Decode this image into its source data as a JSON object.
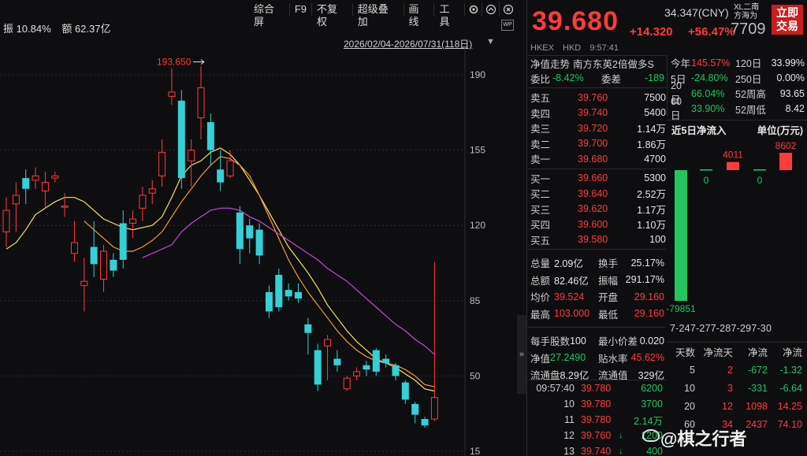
{
  "toolbar": {
    "items": [
      "综合屏",
      "F9",
      "不复权",
      "超级叠加",
      "画线",
      "工具"
    ],
    "icons": [
      "gear-icon",
      "chevron-up-icon",
      "close-icon"
    ]
  },
  "info": {
    "amplitude": "振 10.84%",
    "amount": "额 62.37亿"
  },
  "date_range": "2026/02/04-2026/07/31(118日)",
  "wp_badge": "WP",
  "chart_data": {
    "type": "candlestick",
    "y_ticks": [
      190,
      155,
      120,
      85,
      50,
      15
    ],
    "ylim": [
      15,
      190
    ],
    "annotation": "193.650",
    "candles": [
      {
        "o": 117,
        "c": 127,
        "h": 133,
        "l": 110
      },
      {
        "o": 130,
        "c": 134,
        "h": 140,
        "l": 117
      },
      {
        "o": 142,
        "c": 137,
        "h": 146,
        "l": 130
      },
      {
        "o": 141,
        "c": 143,
        "h": 147,
        "l": 137
      },
      {
        "o": 136,
        "c": 140,
        "h": 145,
        "l": 128
      },
      {
        "o": 142,
        "c": 143,
        "h": 145,
        "l": 140
      },
      {
        "o": 129,
        "c": 129,
        "h": 135,
        "l": 124
      },
      {
        "o": 107,
        "c": 112,
        "h": 122,
        "l": 103
      },
      {
        "o": 92,
        "c": 94,
        "h": 105,
        "l": 80
      },
      {
        "o": 110,
        "c": 102,
        "h": 122,
        "l": 96
      },
      {
        "o": 95,
        "c": 108,
        "h": 111,
        "l": 89
      },
      {
        "o": 104,
        "c": 99,
        "h": 107,
        "l": 96
      },
      {
        "o": 121,
        "c": 104,
        "h": 127,
        "l": 100
      },
      {
        "o": 121,
        "c": 123,
        "h": 127,
        "l": 114
      },
      {
        "o": 128,
        "c": 134,
        "h": 138,
        "l": 122
      },
      {
        "o": 135,
        "c": 137,
        "h": 141,
        "l": 130
      },
      {
        "o": 143,
        "c": 154,
        "h": 160,
        "l": 138
      },
      {
        "o": 180,
        "c": 182,
        "h": 193,
        "l": 176
      },
      {
        "o": 178,
        "c": 142,
        "h": 183,
        "l": 137
      },
      {
        "o": 150,
        "c": 155,
        "h": 160,
        "l": 138
      },
      {
        "o": 170,
        "c": 184,
        "h": 194,
        "l": 160
      },
      {
        "o": 168,
        "c": 155,
        "h": 172,
        "l": 148
      },
      {
        "o": 146,
        "c": 140,
        "h": 155,
        "l": 136
      },
      {
        "o": 143,
        "c": 150,
        "h": 155,
        "l": 142
      },
      {
        "o": 126,
        "c": 109,
        "h": 129,
        "l": 102
      },
      {
        "o": 120,
        "c": 114,
        "h": 123,
        "l": 107
      },
      {
        "o": 118,
        "c": 106,
        "h": 121,
        "l": 102
      },
      {
        "o": 89,
        "c": 80,
        "h": 92,
        "l": 77
      },
      {
        "o": 97,
        "c": 82,
        "h": 100,
        "l": 80
      },
      {
        "o": 90,
        "c": 87,
        "h": 93,
        "l": 85
      },
      {
        "o": 89,
        "c": 86,
        "h": 93,
        "l": 84
      },
      {
        "o": 74,
        "c": 70,
        "h": 77,
        "l": 60
      },
      {
        "o": 62,
        "c": 46,
        "h": 65,
        "l": 43
      },
      {
        "o": 64,
        "c": 67,
        "h": 69,
        "l": 48
      },
      {
        "o": 58,
        "c": 55,
        "h": 62,
        "l": 52
      },
      {
        "o": 44,
        "c": 49,
        "h": 50,
        "l": 43
      },
      {
        "o": 50,
        "c": 52,
        "h": 54,
        "l": 48
      },
      {
        "o": 55,
        "c": 53,
        "h": 57,
        "l": 50
      },
      {
        "o": 62,
        "c": 52,
        "h": 63,
        "l": 50
      },
      {
        "o": 58,
        "c": 56,
        "h": 60,
        "l": 54
      },
      {
        "o": 55,
        "c": 50,
        "h": 56,
        "l": 48
      },
      {
        "o": 47,
        "c": 39,
        "h": 48,
        "l": 37
      },
      {
        "o": 37,
        "c": 32,
        "h": 38,
        "l": 28
      },
      {
        "o": 30,
        "c": 27,
        "h": 31,
        "l": 26
      },
      {
        "o": 30,
        "c": 40,
        "h": 103,
        "l": 29
      }
    ],
    "ma_series": [
      {
        "color": "#f5e26a",
        "values": [
          109,
          112,
          118,
          125,
          128,
          131,
          133,
          133,
          131,
          127,
          123,
          121,
          119,
          118,
          119,
          120,
          124,
          133,
          143,
          148,
          150,
          154,
          156,
          153,
          148,
          141,
          134,
          126,
          118,
          110,
          104,
          98,
          91,
          83,
          77,
          71,
          66,
          62,
          58,
          56,
          54,
          51,
          48,
          44,
          43
        ]
      },
      {
        "color": "#f39c3a",
        "values": [
          null,
          null,
          null,
          null,
          null,
          null,
          null,
          null,
          122,
          118,
          114,
          110,
          108,
          108,
          110,
          113,
          117,
          124,
          131,
          137,
          143,
          148,
          152,
          151,
          148,
          143,
          134,
          124,
          114,
          104,
          96,
          89,
          83,
          77,
          71,
          66,
          62,
          59,
          57,
          56,
          55,
          53,
          50,
          46,
          45
        ]
      },
      {
        "color": "#c44ad6",
        "values": [
          null,
          null,
          null,
          null,
          null,
          null,
          null,
          null,
          null,
          null,
          null,
          null,
          null,
          null,
          105,
          107,
          109,
          111,
          117,
          121,
          124,
          127,
          128,
          128,
          127,
          124,
          122,
          119,
          116,
          113,
          110,
          107,
          104,
          100,
          97,
          94,
          90,
          86,
          82,
          78,
          74,
          71,
          67,
          64,
          60
        ]
      }
    ]
  },
  "quote": {
    "price": "39.680",
    "change": "+14.320",
    "change_pct": "+56.47%",
    "cny": "34.347(CNY)",
    "code_tail": "XL二南方海为",
    "code_num": "7709",
    "trade_button": "立即交易",
    "market": [
      "HKEX",
      "HKD",
      "9:57:41"
    ],
    "net_label": "净值走势",
    "fund_name": "南方东英2倍做多S",
    "weibi_label": "委比",
    "weibi": "-8.42%",
    "weicha_label": "委差",
    "weicha": "-189",
    "asks": [
      {
        "label": "卖五",
        "price": "39.760",
        "vol": "7500"
      },
      {
        "label": "卖四",
        "price": "39.740",
        "vol": "5400"
      },
      {
        "label": "卖三",
        "price": "39.720",
        "vol": "1.14万"
      },
      {
        "label": "卖二",
        "price": "39.700",
        "vol": "1.86万"
      },
      {
        "label": "卖一",
        "price": "39.680",
        "vol": "4700"
      }
    ],
    "bids": [
      {
        "label": "买一",
        "price": "39.660",
        "vol": "5300"
      },
      {
        "label": "买二",
        "price": "39.640",
        "vol": "2.52万"
      },
      {
        "label": "买三",
        "price": "39.620",
        "vol": "1.17万"
      },
      {
        "label": "买四",
        "price": "39.600",
        "vol": "1.10万"
      },
      {
        "label": "买五",
        "price": "39.580",
        "vol": "100"
      }
    ],
    "stats": [
      {
        "l": "总量",
        "v": "2.09亿",
        "vc": "white",
        "l2": "换手",
        "v2": "25.17%",
        "v2c": "white"
      },
      {
        "l": "总额",
        "v": "82.46亿",
        "vc": "white",
        "l2": "振幅",
        "v2": "291.17%",
        "v2c": "white"
      },
      {
        "l": "均价",
        "v": "39.524",
        "vc": "red",
        "l2": "开盘",
        "v2": "29.160",
        "v2c": "red"
      },
      {
        "l": "最高",
        "v": "103.000",
        "vc": "red",
        "l2": "最低",
        "v2": "29.160",
        "v2c": "red"
      }
    ],
    "stats2": [
      {
        "l": "每手股数",
        "v": "100",
        "vc": "white",
        "l2": "最小价差",
        "v2": "0.020",
        "v2c": "white"
      },
      {
        "l": "净值",
        "v": "27.2490",
        "vc": "green",
        "l2": "贴水率",
        "v2": "45.62%",
        "v2c": "red"
      },
      {
        "l": "流通盘",
        "v": "8.29亿",
        "vc": "white",
        "l2": "流通值",
        "v2": "329亿",
        "v2c": "white"
      }
    ],
    "trades": [
      {
        "t": "09:57:40",
        "p": "39.780",
        "q": "6200",
        "arrow": ""
      },
      {
        "t": "10",
        "p": "39.780",
        "q": "3700",
        "arrow": ""
      },
      {
        "t": "11",
        "p": "39.780",
        "q": "2.14万",
        "arrow": ""
      },
      {
        "t": "12",
        "p": "39.760",
        "q": "1200",
        "arrow": "↓"
      },
      {
        "t": "13",
        "p": "39.740",
        "q": "400",
        "arrow": "↓"
      }
    ]
  },
  "performance": [
    {
      "l": "今年",
      "v": "145.57%",
      "vc": "red",
      "l2": "120日",
      "v2": "33.99%",
      "v2c": "red"
    },
    {
      "l": "5日",
      "v": "-24.80%",
      "vc": "green",
      "l2": "250日",
      "v2": "0.00%",
      "v2c": "white"
    },
    {
      "l": "20日",
      "v": "66.04%",
      "vc": "green",
      "l2": "52周高",
      "v2": "93.65",
      "v2c": "white"
    },
    {
      "l": "60日",
      "v": "33.90%",
      "vc": "green",
      "l2": "52周低",
      "v2": "8.42",
      "v2c": "white"
    }
  ],
  "flow": {
    "title": "近5日净流入",
    "unit": "单位(万元)",
    "bars": [
      -79851,
      0,
      4011,
      0,
      8602
    ],
    "labels": [
      "-79851",
      "0",
      "4011",
      "0",
      "8602"
    ],
    "dates": "7-247-277-287-297-30"
  },
  "flow_table": {
    "headers": [
      "天数",
      "净流天",
      "净流",
      "净流"
    ],
    "rows": [
      {
        "c1": "5",
        "c2": "2",
        "c3": "-672",
        "c4": "-1.32"
      },
      {
        "c1": "10",
        "c2": "3",
        "c3": "-331",
        "c4": "-6.64"
      },
      {
        "c1": "20",
        "c2": "12",
        "c3": "1098",
        "c4": "14.25"
      },
      {
        "c1": "60",
        "c2": "34",
        "c3": "2437",
        "c4": "74.10"
      }
    ]
  },
  "watermark": "@棋之行者",
  "side_collapse": "»"
}
